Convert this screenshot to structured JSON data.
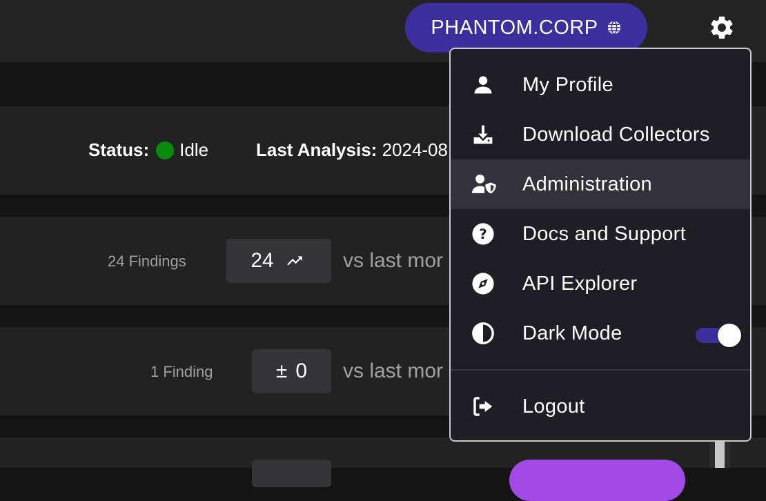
{
  "header": {
    "tenant_label": "PHANTOM.CORP",
    "tenant_icon": "globe-icon",
    "settings_icon": "gear-icon"
  },
  "status_bar": {
    "status_label": "Status:",
    "status_value": "Idle",
    "status_color": "#0a8a0a",
    "last_analysis_label": "Last Analysis:",
    "last_analysis_value": "2024-08"
  },
  "stats": [
    {
      "findings_text": "24 Findings",
      "delta": "24",
      "delta_icon": "trending-up-icon",
      "compare_text": "vs last mor"
    },
    {
      "findings_text": "1 Finding",
      "delta_prefix": "±",
      "delta": "0",
      "compare_text": "vs last mor"
    }
  ],
  "menu": {
    "items": [
      {
        "label": "My Profile",
        "icon": "user-icon"
      },
      {
        "label": "Download Collectors",
        "icon": "download-icon"
      },
      {
        "label": "Administration",
        "icon": "user-shield-icon"
      },
      {
        "label": "Docs and Support",
        "icon": "question-circle-icon"
      },
      {
        "label": "API Explorer",
        "icon": "compass-icon"
      },
      {
        "label": "Dark Mode",
        "icon": "contrast-icon",
        "toggle_on": true
      }
    ],
    "logout": {
      "label": "Logout",
      "icon": "logout-icon"
    }
  },
  "colors": {
    "accent": "#3b2f9e",
    "purple_button": "#a24ae6",
    "menu_bg": "#1f1e26",
    "menu_hover": "#33323a"
  }
}
